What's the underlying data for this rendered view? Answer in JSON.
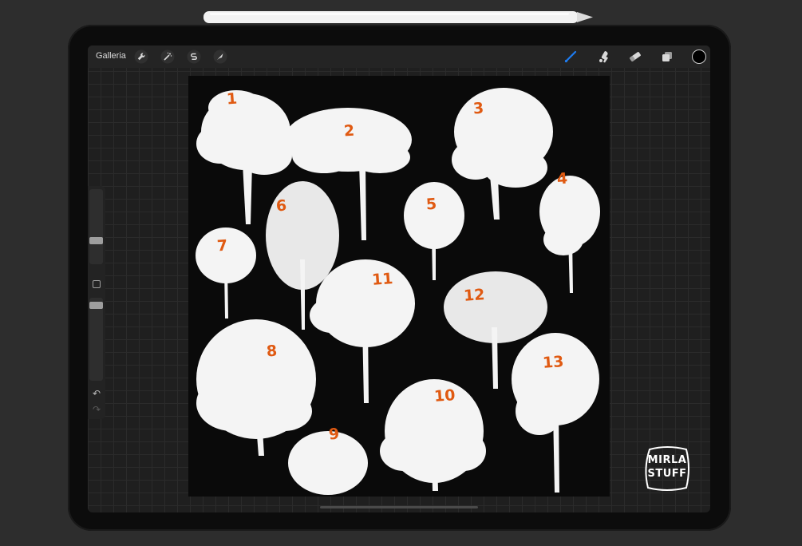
{
  "toolbar": {
    "gallery_label": "Galleria",
    "actions_icon": "wrench-icon",
    "adjustments_icon": "magic-wand-icon",
    "selection_icon": "selection-s-icon",
    "transform_icon": "arrow-cursor-icon",
    "brush_icon": "brush-icon",
    "smudge_icon": "smudge-icon",
    "eraser_icon": "eraser-icon",
    "layers_icon": "layers-icon",
    "active_color": "#000000",
    "accent_color": "#1e7cf0"
  },
  "sidebar": {
    "brush_size_level": 0.3,
    "opacity_level": 0.95,
    "undo_icon": "undo-arrow-icon",
    "redo_icon": "redo-arrow-icon"
  },
  "canvas": {
    "background": "#0a0a0a",
    "label_color": "#e05a12",
    "tree_labels": [
      "1",
      "2",
      "3",
      "4",
      "5",
      "6",
      "7",
      "8",
      "9",
      "10",
      "11",
      "12",
      "13"
    ]
  },
  "logo": {
    "line1": "MIRLA",
    "line2": "STUFF"
  }
}
